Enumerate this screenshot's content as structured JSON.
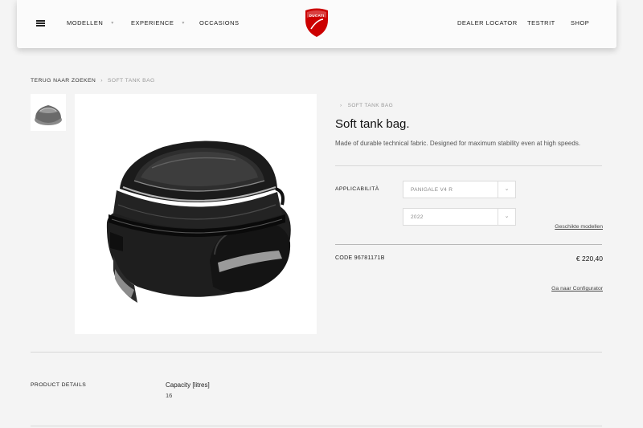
{
  "header": {
    "nav_left": [
      "MODELLEN",
      "EXPERIENCE",
      "OCCASIONS"
    ],
    "nav_right": [
      "DEALER LOCATOR",
      "TESTRIT",
      "SHOP"
    ],
    "logo_text": "DUCATI",
    "brand_color": "#cc0000"
  },
  "breadcrumb": {
    "back": "TERUG NAAR ZOEKEN",
    "separator": "›",
    "current": "SOFT TANK BAG"
  },
  "product": {
    "crumb_chevron": "›",
    "crumb": "SOFT TANK BAG",
    "title": "Soft tank bag.",
    "description": "Made of durable technical fabric. Designed for maximum stability even at high speeds.",
    "applicability_label": "APPLICABILITÀ",
    "model_select": "PANIGALE V4 R",
    "year_select": "2022",
    "select_arrow": "⌄",
    "compatible_models_link": "Geschikte modellen",
    "code": "CODE 96781171B",
    "price": "€ 220,40",
    "configurator_link": "Ga naar Configurator"
  },
  "details": {
    "label": "PRODUCT DETAILS",
    "spec_name": "Capacity [litres]",
    "spec_value": "16"
  }
}
